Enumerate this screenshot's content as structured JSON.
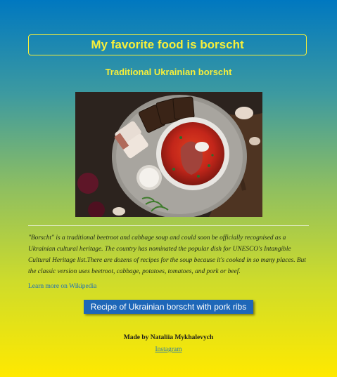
{
  "header": {
    "title": "My favorite food is borscht",
    "subtitle": "Traditional Ukrainian borscht"
  },
  "image": {
    "icon": "borscht-photo"
  },
  "article": {
    "description": "\"Borscht\" is a traditional beetroot and cabbage soup and could soon be officially recognised as a Ukrainian cultural heritage. The country has nominated the popular dish for UNESCO's Intangible Cultural Heritage list.There are dozens of recipes for the soup because it's cooked in so many places. But the classic version uses beetroot, cabbage, potatoes, tomatoes, and pork or beef.",
    "wiki_link": "Learn more on Wikipedia"
  },
  "recipe_button": {
    "label": "Recipe of Ukrainian borscht with pork ribs"
  },
  "footer": {
    "made_by": "Made by Nataliia Mykhalevych",
    "instagram": "Instagram"
  },
  "colors": {
    "gradient_top": "#0078c0",
    "gradient_bottom": "#ffe900",
    "title_yellow": "#f7ef3a",
    "button_blue": "#1e67b8",
    "link_blue": "#1c6fb7"
  }
}
